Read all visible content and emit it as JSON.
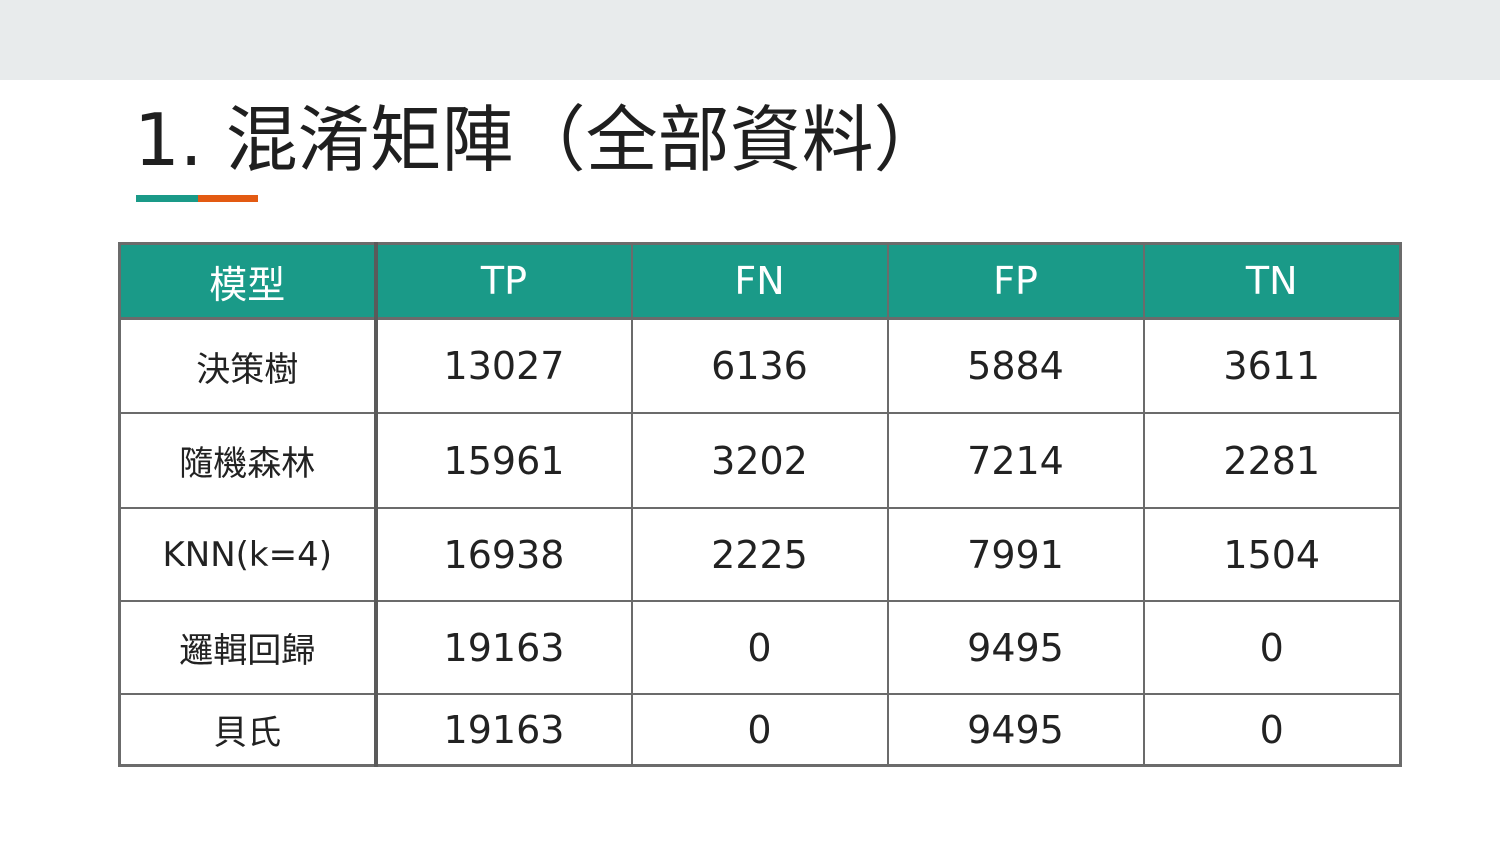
{
  "title": "1. 混淆矩陣（全部資料）",
  "colors": {
    "header_bg": "#1a9a88",
    "accent_teal": "#1a9a88",
    "accent_orange": "#e35a12",
    "top_band": "#e8ebec"
  },
  "table": {
    "headers": [
      "模型",
      "TP",
      "FN",
      "FP",
      "TN"
    ],
    "rows": [
      {
        "model": "決策樹",
        "tp": "13027",
        "fn": "6136",
        "fp": "5884",
        "tn": "3611"
      },
      {
        "model": "隨機森林",
        "tp": "15961",
        "fn": "3202",
        "fp": "7214",
        "tn": "2281"
      },
      {
        "model": "KNN(k=4)",
        "tp": "16938",
        "fn": "2225",
        "fp": "7991",
        "tn": "1504"
      },
      {
        "model": "邏輯回歸",
        "tp": "19163",
        "fn": "0",
        "fp": "9495",
        "tn": "0"
      },
      {
        "model": "貝氏",
        "tp": "19163",
        "fn": "0",
        "fp": "9495",
        "tn": "0"
      }
    ]
  }
}
